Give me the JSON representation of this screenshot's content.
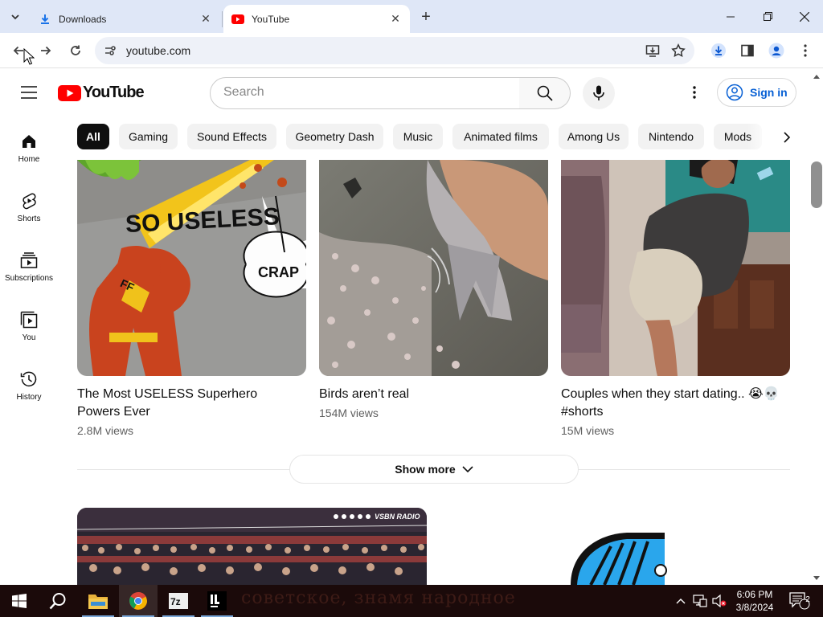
{
  "browser": {
    "tabs": [
      {
        "title": "Downloads",
        "active": false
      },
      {
        "title": "YouTube",
        "active": true
      }
    ],
    "url": "youtube.com"
  },
  "youtube": {
    "logo_text": "YouTube",
    "search_placeholder": "Search",
    "signin_label": "Sign in",
    "sidebar": [
      {
        "label": "Home",
        "icon": "home-icon"
      },
      {
        "label": "Shorts",
        "icon": "shorts-icon"
      },
      {
        "label": "Subscriptions",
        "icon": "subscriptions-icon"
      },
      {
        "label": "You",
        "icon": "you-icon"
      },
      {
        "label": "History",
        "icon": "history-icon"
      }
    ],
    "chips": [
      "All",
      "Gaming",
      "Sound Effects",
      "Geometry Dash",
      "Music",
      "Animated films",
      "Among Us",
      "Nintendo",
      "Mods"
    ],
    "videos": [
      {
        "title": "The Most USELESS Superhero Powers Ever",
        "views": "2.8M views",
        "thumb_text_1": "SO USELESS",
        "thumb_text_2": "CRAP",
        "chest_text": "FF"
      },
      {
        "title": "Birds aren’t real",
        "views": "154M views"
      },
      {
        "title": "Couples when they start dating.. 😭💀 #shorts",
        "views": "15M views"
      }
    ],
    "show_more": "Show more",
    "next_row_watermark": "VSBN RADIO"
  },
  "taskbar": {
    "time": "6:06 PM",
    "date": "3/8/2024",
    "notifications": "2",
    "wallpaper_text": "советское, знамя народное",
    "apps": [
      "File Explorer",
      "Google Chrome",
      "7-Zip",
      "IntelliJ IDEA"
    ]
  },
  "colors": {
    "youtube_red": "#ff0000",
    "link_blue": "#065fd4",
    "tab_strip": "#dfe7f7",
    "chip_bg": "#f2f2f2"
  }
}
